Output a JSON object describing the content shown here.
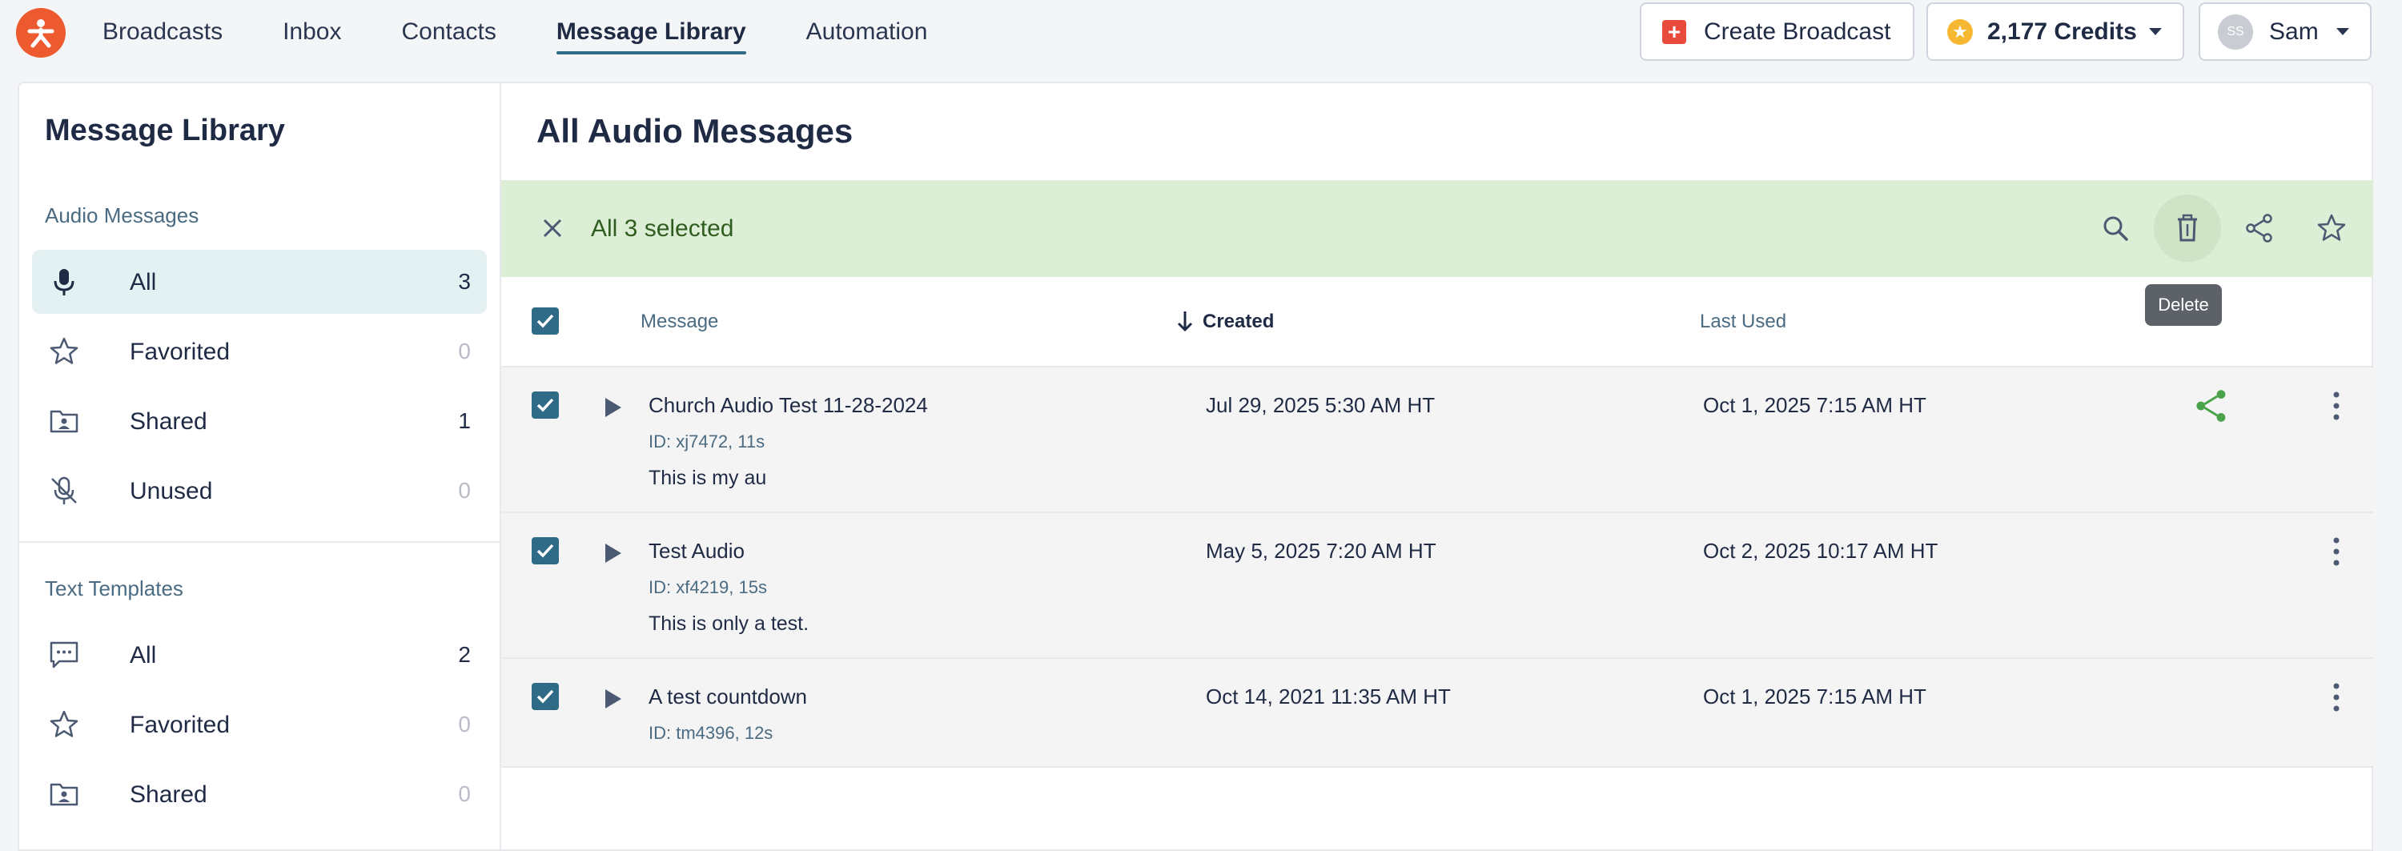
{
  "nav": {
    "links": [
      "Broadcasts",
      "Inbox",
      "Contacts",
      "Message Library",
      "Automation"
    ],
    "active_index": 3,
    "create_label": "Create Broadcast",
    "credits_label": "2,177 Credits",
    "user_initials": "SS",
    "user_name": "Sam"
  },
  "sidebar": {
    "title": "Message Library",
    "audio_section": "Audio Messages",
    "audio_items": [
      {
        "label": "All",
        "count": "3",
        "icon": "microphone-icon"
      },
      {
        "label": "Favorited",
        "count": "0",
        "icon": "star-icon"
      },
      {
        "label": "Shared",
        "count": "1",
        "icon": "shared-folder-icon"
      },
      {
        "label": "Unused",
        "count": "0",
        "icon": "microphone-off-icon"
      }
    ],
    "text_section": "Text Templates",
    "text_items": [
      {
        "label": "All",
        "count": "2",
        "icon": "chat-bubble-icon"
      },
      {
        "label": "Favorited",
        "count": "0",
        "icon": "star-icon"
      },
      {
        "label": "Shared",
        "count": "0",
        "icon": "shared-folder-icon"
      }
    ]
  },
  "main": {
    "title": "All Audio Messages",
    "selection_text": "All 3 selected",
    "tooltip": "Delete",
    "columns": {
      "message": "Message",
      "created": "Created",
      "last_used": "Last Used"
    },
    "rows": [
      {
        "name": "Church Audio Test 11-28-2024",
        "id": "ID: xj7472, 11s",
        "text": "This is my au",
        "created": "Jul 29, 2025 5:30 AM HT",
        "last_used": "Oct 1, 2025 7:15 AM HT",
        "shared": true
      },
      {
        "name": "Test Audio",
        "id": "ID: xf4219, 15s",
        "text": "This is only a test.",
        "created": "May 5, 2025 7:20 AM HT",
        "last_used": "Oct 2, 2025 10:17 AM HT",
        "shared": false
      },
      {
        "name": "A test countdown",
        "id": "ID: tm4396, 12s",
        "text": "",
        "created": "Oct 14, 2021 11:35 AM HT",
        "last_used": "Oct 1, 2025 7:15 AM HT",
        "shared": false
      }
    ]
  },
  "colors": {
    "accent": "#2f6a86",
    "brand": "#ee5a2f",
    "selection_bar": "#dceed5",
    "share_green": "#4aa34a"
  }
}
